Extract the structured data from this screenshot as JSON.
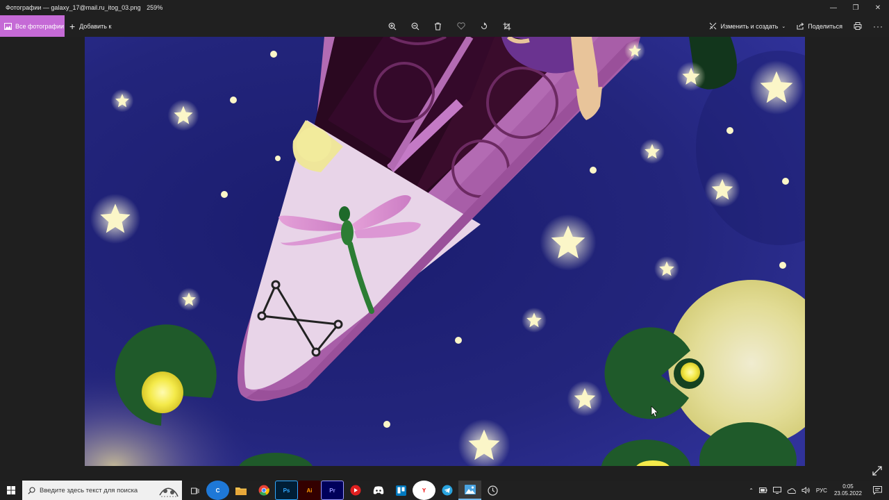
{
  "window": {
    "title": "Фотографии — galaxy_17@mail.ru_itog_03.png",
    "zoom": "259%"
  },
  "toolbar": {
    "all_photos_label": "Все фотографии",
    "add_to_label": "Добавить к",
    "edit_create_label": "Изменить и создать",
    "share_label": "Поделиться",
    "tools": [
      "zoom-in-icon",
      "zoom-out-icon",
      "delete-icon",
      "favorite-icon",
      "rotate-icon",
      "crop-icon"
    ]
  },
  "taskbar": {
    "search_placeholder": "Введите здесь текст для поиска",
    "language": "РУС",
    "time": "0:05",
    "date": "23.05.2022",
    "apps": [
      {
        "name": "task-view-icon",
        "label": ""
      },
      {
        "name": "ccleaner-icon",
        "label": "C",
        "color": "#1e78d7"
      },
      {
        "name": "file-explorer-icon",
        "label": "",
        "color": "#f2c14e"
      },
      {
        "name": "chrome-icon",
        "label": "",
        "color": "#e94235"
      },
      {
        "name": "photoshop-icon",
        "label": "Ps",
        "color": "#001e36"
      },
      {
        "name": "illustrator-icon",
        "label": "Ai",
        "color": "#330000"
      },
      {
        "name": "premiere-icon",
        "label": "Pr",
        "color": "#00005b"
      },
      {
        "name": "media-player-icon",
        "label": "",
        "color": "#e02020"
      },
      {
        "name": "discord-icon",
        "label": "",
        "color": "#5865f2"
      },
      {
        "name": "trello-icon",
        "label": "",
        "color": "#0079bf"
      },
      {
        "name": "yandex-browser-icon",
        "label": "Y",
        "color": "#ffffff"
      },
      {
        "name": "telegram-icon",
        "label": "",
        "color": "#2aa3de"
      },
      {
        "name": "photos-app-icon",
        "label": "",
        "color": "#4aa3e0"
      },
      {
        "name": "clock-app-icon",
        "label": "",
        "color": "#888888"
      }
    ]
  },
  "colors": {
    "accent": "#c56ad6",
    "sky": "#2a2c8a",
    "boat": "#e8d4e8",
    "boat_rim": "#a85ea8",
    "lily_pad": "#1f5a2a",
    "moon": "#e4e09a",
    "star": "#fbf6c8"
  }
}
